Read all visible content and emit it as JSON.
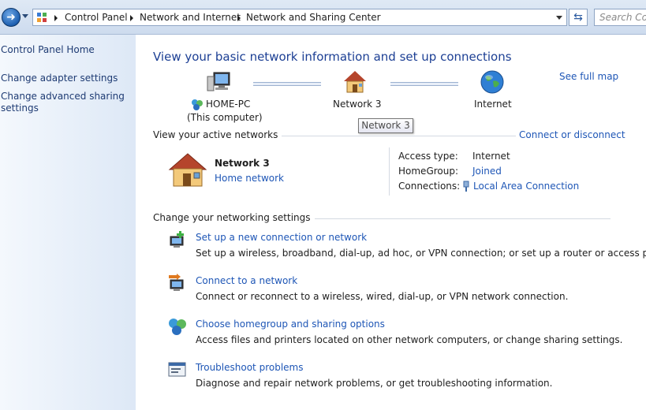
{
  "address_bar": {
    "crumbs": [
      "Control Panel",
      "Network and Internet",
      "Network and Sharing Center"
    ],
    "search_placeholder": "Search Con"
  },
  "sidebar": {
    "items": [
      {
        "label": "Control Panel Home"
      },
      {
        "label": "Change adapter settings"
      },
      {
        "label": "Change advanced sharing"
      },
      {
        "label": "settings"
      }
    ]
  },
  "main": {
    "title": "View your basic network information and set up connections",
    "see_full_map": "See full map",
    "map": {
      "computer_name": "HOME-PC",
      "computer_sub": "(This computer)",
      "network": "Network  3",
      "internet": "Internet"
    },
    "tooltip": "Network  3",
    "active_networks": {
      "heading": "View your active networks",
      "connect_disconnect": "Connect or disconnect",
      "network_name": "Network  3",
      "network_type": "Home network",
      "access_type_label": "Access type:",
      "access_type_value": "Internet",
      "homegroup_label": "HomeGroup:",
      "homegroup_value": "Joined",
      "connections_label": "Connections:",
      "connections_value": "Local Area Connection"
    },
    "change_settings": {
      "heading": "Change your networking settings",
      "tasks": [
        {
          "link": "Set up a new connection or network",
          "icon": "new-connection-icon",
          "desc": "Set up a wireless, broadband, dial-up, ad hoc, or VPN connection; or set up a router or access point."
        },
        {
          "link": "Connect to a network",
          "icon": "connect-network-icon",
          "desc": "Connect or reconnect to a wireless, wired, dial-up, or VPN network connection."
        },
        {
          "link": "Choose homegroup and sharing options",
          "icon": "homegroup-icon",
          "desc": "Access files and printers located on other network computers, or change sharing settings."
        },
        {
          "link": "Troubleshoot problems",
          "icon": "troubleshoot-icon",
          "desc": "Diagnose and repair network problems, or get troubleshooting information."
        }
      ]
    }
  },
  "colors": {
    "link": "#1e56b6",
    "title": "#1c3f94",
    "sidebar_bg": "#dde8f6"
  }
}
